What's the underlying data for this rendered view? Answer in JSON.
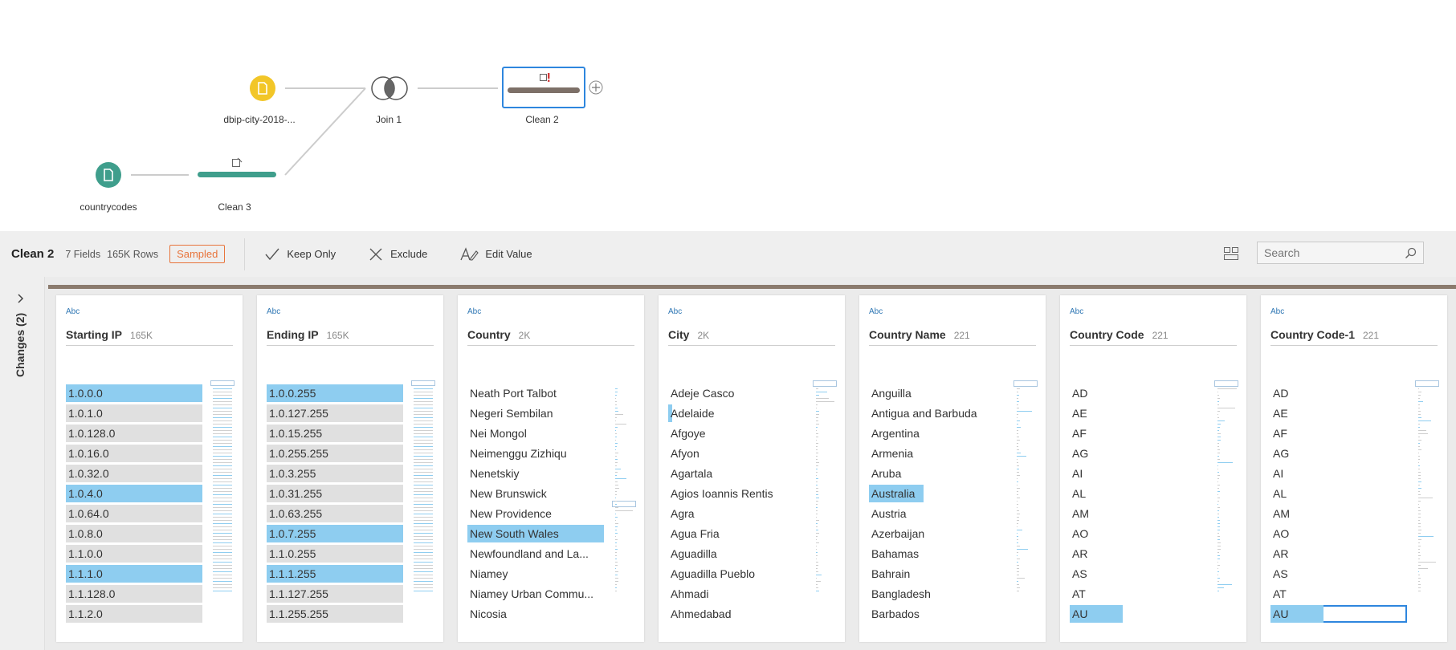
{
  "flow": {
    "nodes": [
      {
        "label": "dbip-city-2018-...",
        "color": "#f2c628"
      },
      {
        "label": "countrycodes",
        "color": "#3f9e8c"
      },
      {
        "label": "Clean 3",
        "color": "#3f9e8c"
      },
      {
        "label": "Join 1"
      },
      {
        "label": "Clean 2",
        "color": "#7d7068"
      }
    ]
  },
  "toolbar": {
    "title": "Clean 2",
    "fields": "7 Fields",
    "rows": "165K Rows",
    "badge": "Sampled",
    "keep_only": "Keep Only",
    "exclude": "Exclude",
    "edit_value": "Edit Value",
    "search_placeholder": "Search"
  },
  "sidebar": {
    "changes_label": "Changes (2)"
  },
  "colors": {
    "selected": "#8ecdf0",
    "unselected": "#e0e0e0",
    "accent": "#2e86de",
    "badge": "#e8743b",
    "brown": "#8b7b6e"
  },
  "columns": [
    {
      "type": "Abc",
      "name": "Starting IP",
      "count": "165K",
      "bars": true,
      "values": [
        "1.0.0.0",
        "1.0.1.0",
        "1.0.128.0",
        "1.0.16.0",
        "1.0.32.0",
        "1.0.4.0",
        "1.0.64.0",
        "1.0.8.0",
        "1.1.0.0",
        "1.1.1.0",
        "1.1.128.0",
        "1.1.2.0"
      ],
      "selected": [
        0,
        5,
        9
      ]
    },
    {
      "type": "Abc",
      "name": "Ending IP",
      "count": "165K",
      "bars": true,
      "values": [
        "1.0.0.255",
        "1.0.127.255",
        "1.0.15.255",
        "1.0.255.255",
        "1.0.3.255",
        "1.0.31.255",
        "1.0.63.255",
        "1.0.7.255",
        "1.1.0.255",
        "1.1.1.255",
        "1.1.127.255",
        "1.1.255.255"
      ],
      "selected": [
        0,
        7,
        9
      ]
    },
    {
      "type": "Abc",
      "name": "Country",
      "count": "2K",
      "bars": false,
      "values": [
        "Neath Port Talbot",
        "Negeri Sembilan",
        "Nei Mongol",
        "Neimenggu Zizhiqu",
        "Nenetskiy",
        "New Brunswick",
        "New Providence",
        "New South Wales",
        "Newfoundland and La...",
        "Niamey",
        "Niamey Urban Commu...",
        "Nicosia"
      ],
      "selected": [
        7
      ]
    },
    {
      "type": "Abc",
      "name": "City",
      "count": "2K",
      "bars": false,
      "values": [
        "Adeje Casco",
        "Adelaide",
        "Afgoye",
        "Afyon",
        "Agartala",
        "Agios Ioannis Rentis",
        "Agra",
        "Agua Fria",
        "Aguadilla",
        "Aguadilla Pueblo",
        "Ahmadi",
        "Ahmedabad"
      ],
      "selected": [
        1
      ]
    },
    {
      "type": "Abc",
      "name": "Country Name",
      "count": "221",
      "bars": false,
      "values": [
        "Anguilla",
        "Antigua and Barbuda",
        "Argentina",
        "Armenia",
        "Aruba",
        "Australia",
        "Austria",
        "Azerbaijan",
        "Bahamas",
        "Bahrain",
        "Bangladesh",
        "Barbados"
      ],
      "selected": [
        5
      ]
    },
    {
      "type": "Abc",
      "name": "Country Code",
      "count": "221",
      "bars": false,
      "values": [
        "AD",
        "AE",
        "AF",
        "AG",
        "AI",
        "AL",
        "AM",
        "AO",
        "AR",
        "AS",
        "AT",
        "AU"
      ],
      "selected": [
        11
      ]
    },
    {
      "type": "Abc",
      "name": "Country Code-1",
      "count": "221",
      "bars": false,
      "values": [
        "AD",
        "AE",
        "AF",
        "AG",
        "AI",
        "AL",
        "AM",
        "AO",
        "AR",
        "AS",
        "AT",
        "AU"
      ],
      "selected": [
        11
      ],
      "focused": 11
    }
  ]
}
